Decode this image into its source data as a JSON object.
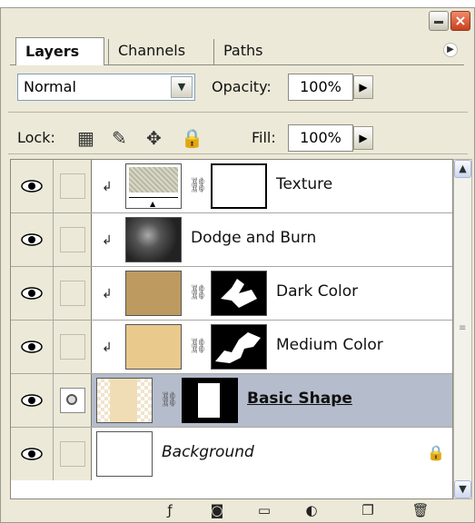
{
  "tabs": [
    "Layers",
    "Channels",
    "Paths"
  ],
  "blend_mode": "Normal",
  "opacity": {
    "label": "Opacity:",
    "value": "100%"
  },
  "lock_label": "Lock:",
  "fill": {
    "label": "Fill:",
    "value": "100%"
  },
  "layers": [
    {
      "name": "Texture",
      "visible": true,
      "clipped": true,
      "has_mask": true,
      "selected": false
    },
    {
      "name": "Dodge and Burn",
      "visible": true,
      "clipped": true,
      "has_mask": false,
      "selected": false
    },
    {
      "name": "Dark Color",
      "visible": true,
      "clipped": true,
      "has_mask": true,
      "selected": false
    },
    {
      "name": "Medium Color",
      "visible": true,
      "clipped": true,
      "has_mask": true,
      "selected": false
    },
    {
      "name": "Basic Shape",
      "visible": true,
      "clipped": false,
      "has_mask": true,
      "selected": true
    },
    {
      "name": "Background",
      "visible": true,
      "clipped": false,
      "has_mask": false,
      "selected": false,
      "locked": true
    }
  ],
  "colors": {
    "selected_row": "#b5bccb",
    "dark_color_fill": "#bc9a60",
    "medium_color_fill": "#e9c98c"
  },
  "bottom_icons": [
    "layer-style-icon",
    "add-mask-icon",
    "new-group-icon",
    "adjustment-layer-icon",
    "new-layer-icon",
    "trash-icon"
  ]
}
